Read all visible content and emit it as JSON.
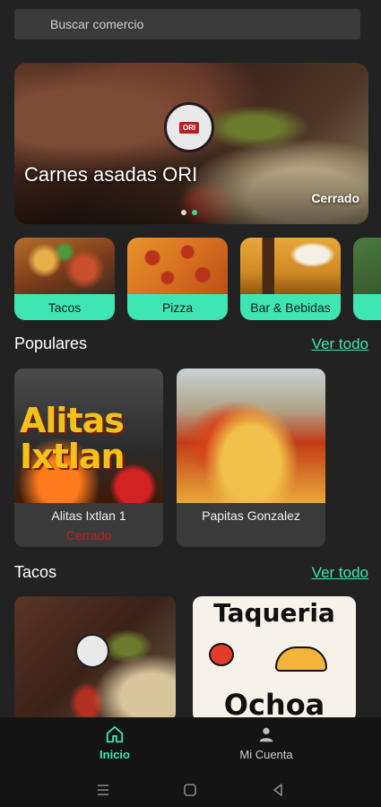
{
  "search": {
    "placeholder": "Buscar comercio"
  },
  "hero": {
    "title": "Carnes asadas ORI",
    "status": "Cerrado",
    "logo_text": "ORI",
    "active_slide": 2,
    "slide_count": 2
  },
  "categories": [
    {
      "label": "Tacos"
    },
    {
      "label": "Pizza"
    },
    {
      "label": "Bar & Bebidas"
    }
  ],
  "populares": {
    "title": "Populares",
    "link": "Ver todo",
    "items": [
      {
        "name": "Alitas Ixtlan 1",
        "status": "Cerrado",
        "image_text": "Alitas Ixtlan"
      },
      {
        "name": "Papitas Gonzalez",
        "status": ""
      }
    ]
  },
  "tacos": {
    "title": "Tacos",
    "link": "Ver todo",
    "items": [
      {
        "image_text_top": "",
        "image_text_bottom": ""
      },
      {
        "image_text_top": "Taqueria",
        "image_text_bottom": "Ochoa"
      }
    ]
  },
  "nav": {
    "home": "Inicio",
    "account": "Mi Cuenta"
  },
  "colors": {
    "accent": "#3ee6b4",
    "background": "#222222",
    "closed": "#c0201d"
  }
}
